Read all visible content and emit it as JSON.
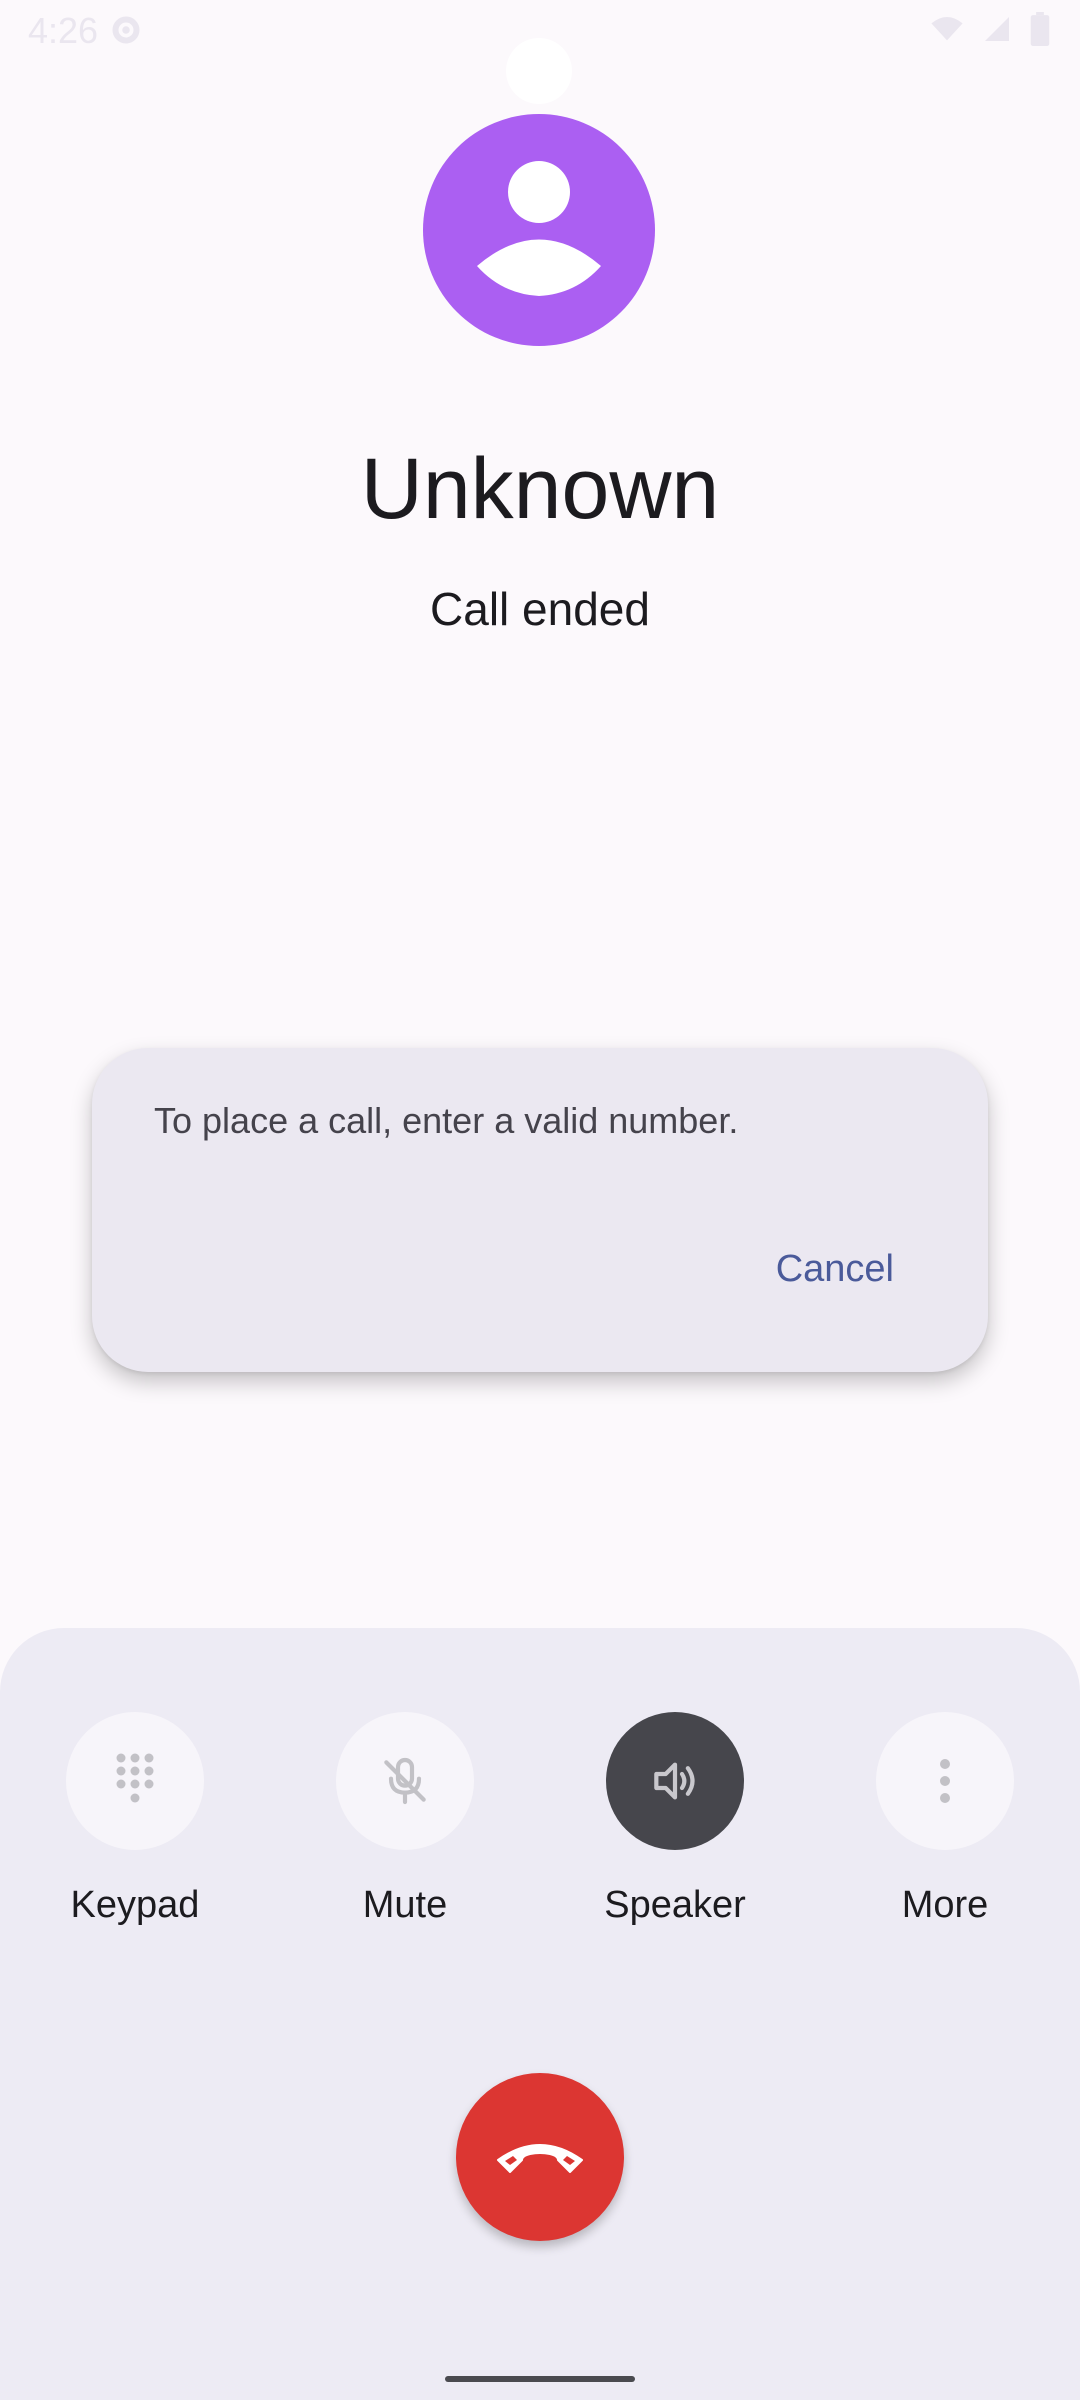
{
  "status_bar": {
    "time": "4:26",
    "icons": [
      "settings-icon",
      "wifi-icon",
      "signal-icon",
      "battery-icon"
    ]
  },
  "caller": {
    "name": "Unknown",
    "status": "Call ended",
    "avatar_icon": "person-icon",
    "avatar_color": "#ab5ff2"
  },
  "dialog": {
    "message": "To place a call, enter a valid number.",
    "cancel_label": "Cancel"
  },
  "controls": {
    "keypad_label": "Keypad",
    "mute_label": "Mute",
    "speaker_label": "Speaker",
    "more_label": "More",
    "speaker_active": true
  },
  "end_call": {
    "icon": "hang-up-icon",
    "color": "#dc3632"
  }
}
